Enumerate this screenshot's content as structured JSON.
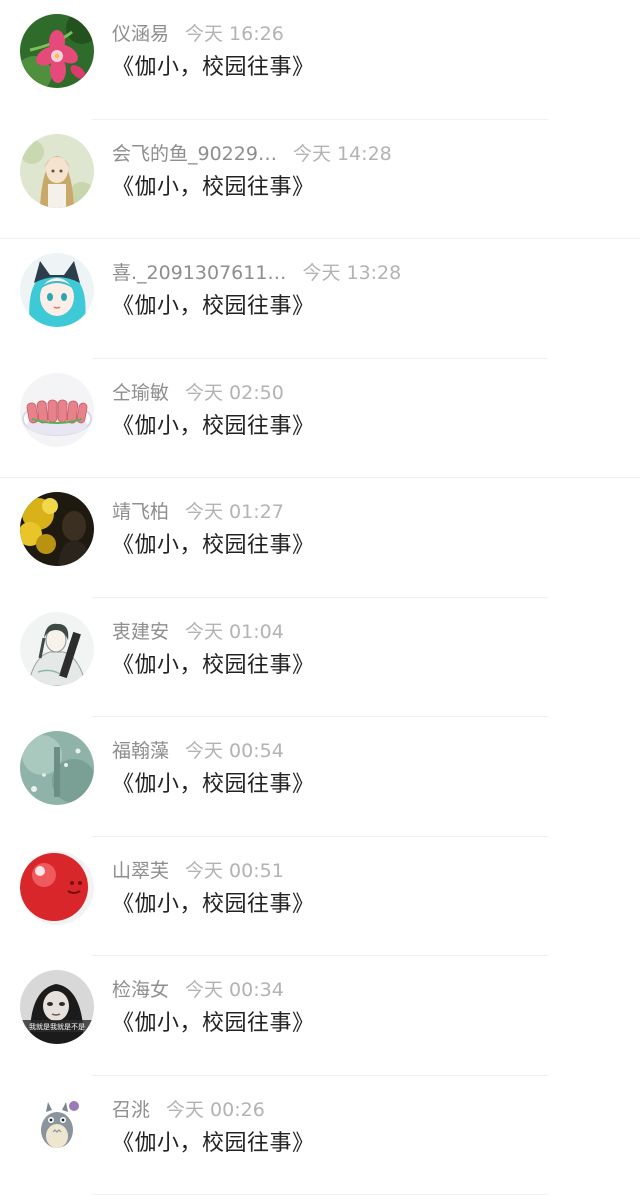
{
  "messages": [
    {
      "name": "仪涵易",
      "time": "今天 16:26",
      "text": "《伽小，校园往事》",
      "avatar": "pink-flower-avatar"
    },
    {
      "name": "会飞的鱼_90229…",
      "time": "今天 14:28",
      "text": "《伽小，校园往事》",
      "avatar": "anime-girl-avatar"
    },
    {
      "name": "喜._2091307611…",
      "time": "今天 13:28",
      "text": "《伽小，校园往事》",
      "avatar": "cat-ear-girl-avatar"
    },
    {
      "name": "仝瑜敏",
      "time": "今天 02:50",
      "text": "《伽小，校园往事》",
      "avatar": "food-plate-avatar"
    },
    {
      "name": "靖飞柏",
      "time": "今天 01:27",
      "text": "《伽小，校园往事》",
      "avatar": "yellow-flowers-avatar"
    },
    {
      "name": "衷建安",
      "time": "今天 01:04",
      "text": "《伽小，校园往事》",
      "avatar": "sketch-boy-avatar"
    },
    {
      "name": "福翰藻",
      "time": "今天 00:54",
      "text": "《伽小，校园往事》",
      "avatar": "teal-mist-avatar"
    },
    {
      "name": "山翠芙",
      "time": "今天 00:51",
      "text": "《伽小，校园往事》",
      "avatar": "red-ball-avatar"
    },
    {
      "name": "检海女",
      "time": "今天 00:34",
      "text": "《伽小，校园往事》",
      "avatar": "woman-bw-avatar"
    },
    {
      "name": "召洮",
      "time": "今天 00:26",
      "text": "《伽小，校园往事》",
      "avatar": "totoro-avatar"
    }
  ],
  "avatar_caption": "我就是我就是不是"
}
